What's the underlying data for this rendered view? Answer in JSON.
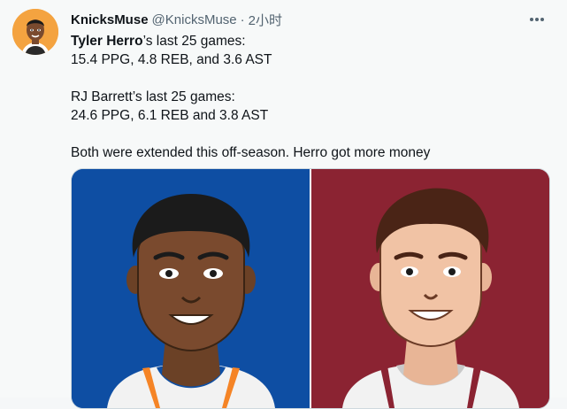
{
  "tweet": {
    "display_name": "KnicksMuse",
    "handle": "@KnicksMuse",
    "separator": "·",
    "time": "2小时",
    "line1_name": "Tyler Herro",
    "line1_rest": "’s last 25 games:",
    "line2": "15.4 PPG, 4.8 REB, and 3.6 AST",
    "line3": "RJ Barrett’s last 25 games:",
    "line4": "24.6 PPG, 6.1 REB and 3.8 AST",
    "line5": "Both were extended this off-season. Herro got more money"
  },
  "colors": {
    "knicks_blue": "#0e4ea3",
    "heat_red": "#8b2332",
    "avatar_orange": "#f4a340"
  },
  "icons": {
    "more": "more-horizontal-icon"
  }
}
